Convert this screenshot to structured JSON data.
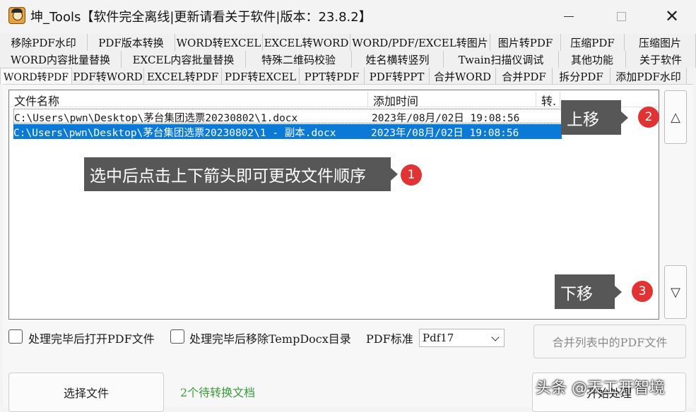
{
  "window": {
    "title": "坤_Tools【软件完全离线|更新请看关于软件|版本：23.8.2】",
    "minimize": "",
    "maximize": "",
    "close": "✕"
  },
  "tabs": {
    "row1": [
      "移除PDF水印",
      "PDF版本转换",
      "WORD转EXCEL",
      "EXCEL转WORD",
      "WORD/PDF/EXCEL转图片",
      "图片转PDF",
      "压缩PDF",
      "压缩图片"
    ],
    "row2": [
      "WORD内容批量替换",
      "EXCEL内容批量替换",
      "特殊二维码校验",
      "姓名横转竖列",
      "Twain扫描仪调试",
      "其他功能",
      "关于软件"
    ],
    "row3": [
      "WORD转PDF",
      "PDF转WORD",
      "EXCEL转PDF",
      "PDF转EXCEL",
      "PPT转PDF",
      "PDF转PPT",
      "合并WORD",
      "合并PDF",
      "拆分PDF",
      "添加PDF水印"
    ],
    "active": "WORD转PDF"
  },
  "file_list": {
    "columns": [
      "文件名称",
      "添加时间",
      "转."
    ],
    "rows": [
      {
        "name": "C:\\Users\\pwn\\Desktop\\茅台集团选票20230802\\1.docx",
        "time": "2023年/08月/02日  19:08:56"
      },
      {
        "name": "C:\\Users\\pwn\\Desktop\\茅台集团选票20230802\\1 - 副本.docx",
        "time": "2023年/08月/02日  19:08:56"
      }
    ]
  },
  "callouts": {
    "hint": {
      "text": "选中后点击上下箭头即可更改文件顺序",
      "badge": "1"
    },
    "up": {
      "text": "上移",
      "badge": "2"
    },
    "down": {
      "text": "下移",
      "badge": "3"
    }
  },
  "arrows": {
    "up": "△",
    "down": "▽"
  },
  "options": {
    "open_pdf_after": "处理完毕后打开PDF文件",
    "remove_temp": "处理完毕后移除TempDocx目录",
    "pdf_standard_label": "PDF标准",
    "pdf_standard_value": "Pdf17"
  },
  "buttons": {
    "merge_list_pdf": "合并列表中的PDF文件",
    "select_files": "选择文件",
    "start": "开始处理"
  },
  "status": "2个待转换文档",
  "watermark": "头条 @天工开智境"
}
